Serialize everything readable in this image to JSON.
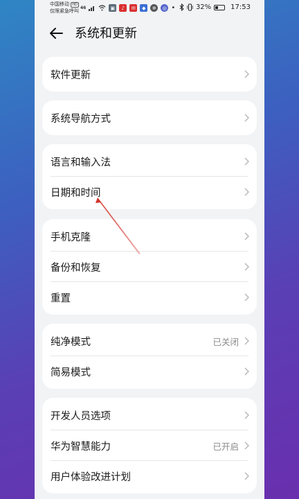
{
  "status_bar": {
    "carrier": "中国移动",
    "carrier_badge": "HD",
    "emergency": "仅限紧急呼叫",
    "signal": "46",
    "battery": "32%",
    "battery_level": 0.32,
    "time": "17:53"
  },
  "header": {
    "title": "系统和更新"
  },
  "groups": [
    {
      "items": [
        {
          "label": "软件更新",
          "value": ""
        }
      ]
    },
    {
      "items": [
        {
          "label": "系统导航方式",
          "value": ""
        }
      ]
    },
    {
      "items": [
        {
          "label": "语言和输入法",
          "value": ""
        },
        {
          "label": "日期和时间",
          "value": ""
        }
      ]
    },
    {
      "items": [
        {
          "label": "手机克隆",
          "value": ""
        },
        {
          "label": "备份和恢复",
          "value": ""
        },
        {
          "label": "重置",
          "value": ""
        }
      ]
    },
    {
      "items": [
        {
          "label": "纯净模式",
          "value": "已关闭"
        },
        {
          "label": "简易模式",
          "value": ""
        }
      ]
    },
    {
      "items": [
        {
          "label": "开发人员选项",
          "value": ""
        },
        {
          "label": "华为智慧能力",
          "value": "已开启"
        },
        {
          "label": "用户体验改进计划",
          "value": ""
        }
      ]
    }
  ],
  "colors": {
    "annotation_arrow": "#d2332a",
    "accent_bg": "#4a53b8"
  }
}
